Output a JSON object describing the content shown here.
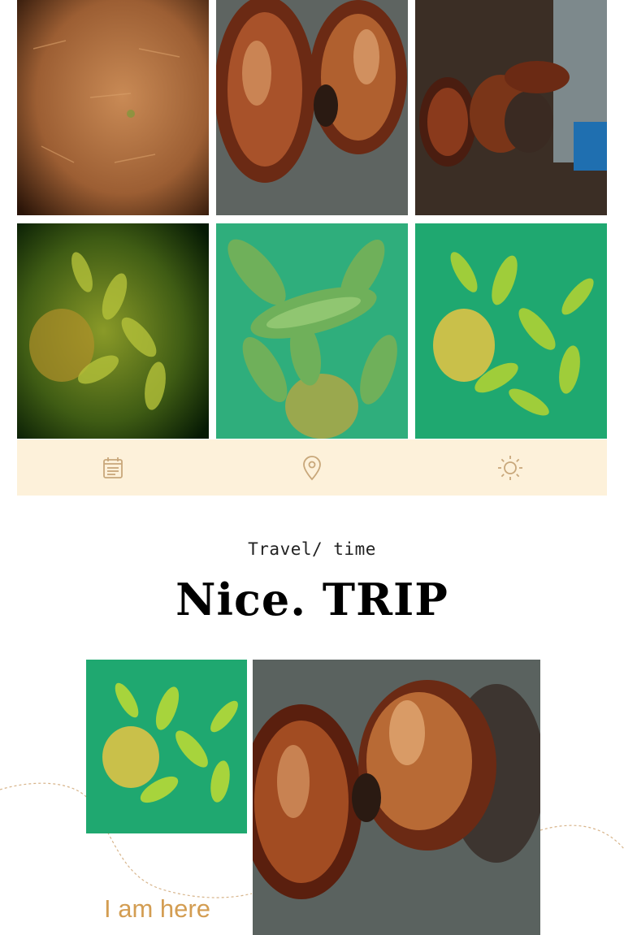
{
  "photos": [
    {
      "subject": "sandy-soil"
    },
    {
      "subject": "two-snails"
    },
    {
      "subject": "snails-by-bottle"
    },
    {
      "subject": "leaves-dark-bowl"
    },
    {
      "subject": "leaves-and-fruit"
    },
    {
      "subject": "leaves-green-bowl"
    }
  ],
  "iconbar": {
    "background": "#fdf1da",
    "icon_color": "#c8a77a",
    "icons": [
      "calendar-icon",
      "location-pin-icon",
      "sun-icon"
    ]
  },
  "heading": {
    "subtitle": "Travel/ time",
    "title": "Nice. TRIP"
  },
  "footer": {
    "label": "I am here",
    "accent": "#d39d52"
  }
}
